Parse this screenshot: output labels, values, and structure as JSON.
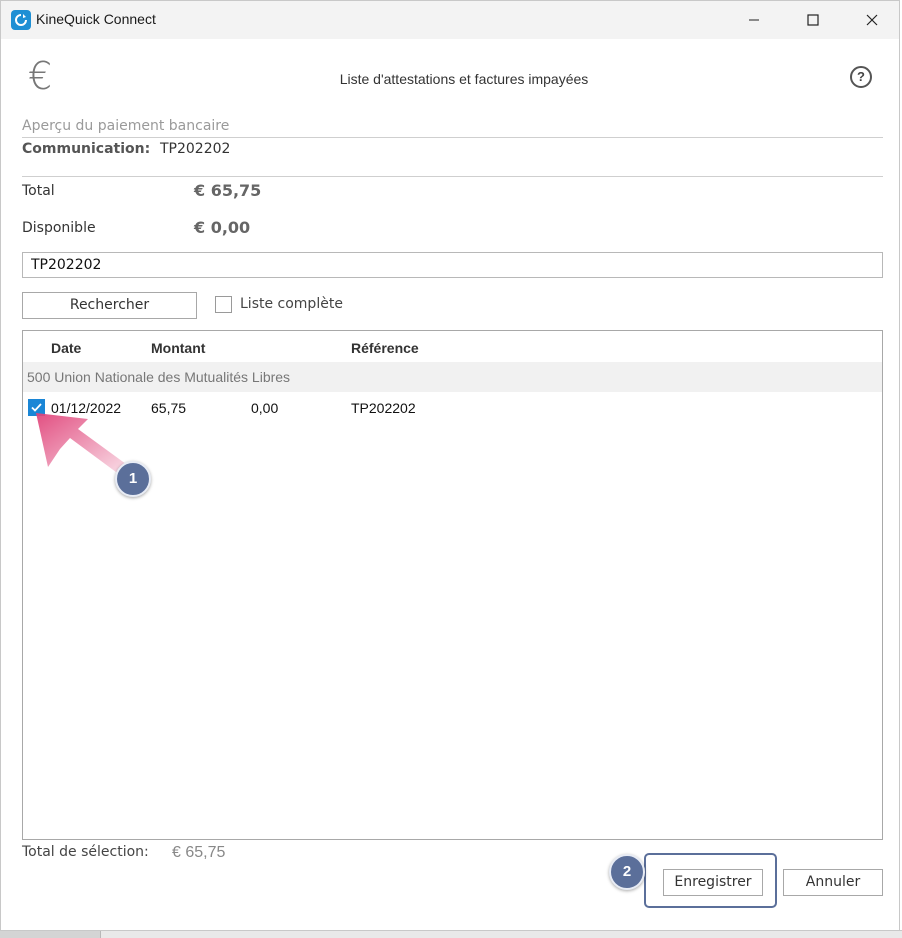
{
  "window": {
    "title": "KineQuick Connect",
    "icons": {
      "app": "app-logo-icon",
      "minimize": "minimize-icon",
      "maximize": "maximize-icon",
      "close": "close-icon"
    }
  },
  "header": {
    "currency_symbol": "€",
    "title": "Liste d'attestations et factures impayées",
    "help_symbol": "?"
  },
  "payment": {
    "section_label": "Aperçu du paiement bancaire",
    "communication_label": "Communication:",
    "communication_value": "TP202202",
    "total_label": "Total",
    "total_value": "€  65,75",
    "available_label": "Disponible",
    "available_value": "€  0,00"
  },
  "search": {
    "value": "TP202202",
    "button_label": "Rechercher",
    "full_list_label": "Liste complète",
    "full_list_checked": false
  },
  "table": {
    "columns": [
      "Date",
      "Montant",
      "Référence"
    ],
    "group": "500 Union Nationale des Mutualités Libres",
    "rows": [
      {
        "checked": true,
        "date": "01/12/2022",
        "amount": "65,75",
        "available": "0,00",
        "reference": "TP202202"
      }
    ]
  },
  "footer": {
    "selection_label": "Total de sélection:",
    "selection_value": "€ 65,75",
    "save_label": "Enregistrer",
    "cancel_label": "Annuler"
  },
  "annotations": {
    "marker_1": "1",
    "marker_2": "2",
    "color": "#5b6f9a",
    "arrow_color": "#e0457a"
  },
  "colors": {
    "checkbox_accent": "#1a86d6",
    "group_row_bg": "#f1f1f1"
  }
}
